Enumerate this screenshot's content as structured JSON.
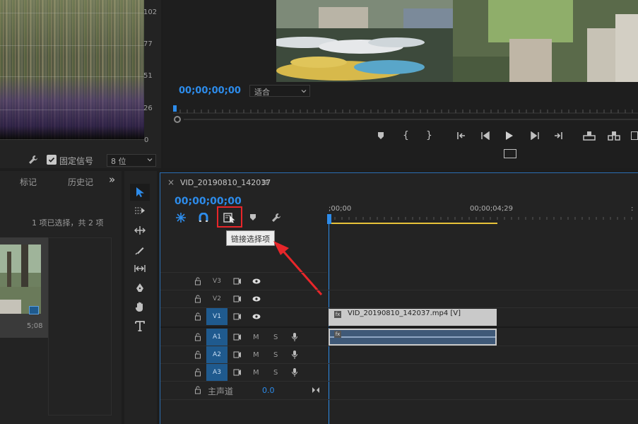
{
  "scope": {
    "ticks": [
      "102",
      "77",
      "51",
      "26",
      "0"
    ],
    "fixed_signal_label": "固定信号",
    "fixed_signal_checked": true,
    "bit_depth": "8 位"
  },
  "program": {
    "timecode": "00;00;00;00",
    "fit_select": "适合"
  },
  "left_panel": {
    "tab_markers": "标记",
    "tab_history": "历史记",
    "more": "»",
    "selection_status": "1 项已选择，共 2 项",
    "thumb_duration": "5;08"
  },
  "timeline": {
    "sequence_name": "VID_20190810_142037",
    "close": "×",
    "menu": "≡",
    "timecode": "00;00;00;00",
    "ruler_start": ";00;00",
    "ruler_mid": "00;00;04;29",
    "tooltip": "链接选择项",
    "tracks": {
      "video": [
        {
          "name": "V3",
          "active": false
        },
        {
          "name": "V2",
          "active": false
        },
        {
          "name": "V1",
          "active": true
        }
      ],
      "audio": [
        {
          "name": "A1",
          "active": true
        },
        {
          "name": "A2",
          "active": true
        },
        {
          "name": "A3",
          "active": true
        }
      ],
      "m_label": "M",
      "s_label": "S"
    },
    "master_label": "主声道",
    "master_value": "0.0",
    "clip_label": "VID_20190810_142037.mp4 [V]",
    "fx_badge": "fx"
  },
  "colors": {
    "accent_blue": "#2d8ceb",
    "highlight_red": "#e8262a",
    "work_area_yellow": "#e8c23a",
    "video_clip": "#c9c9c9",
    "audio_clip": "#3f5978"
  }
}
